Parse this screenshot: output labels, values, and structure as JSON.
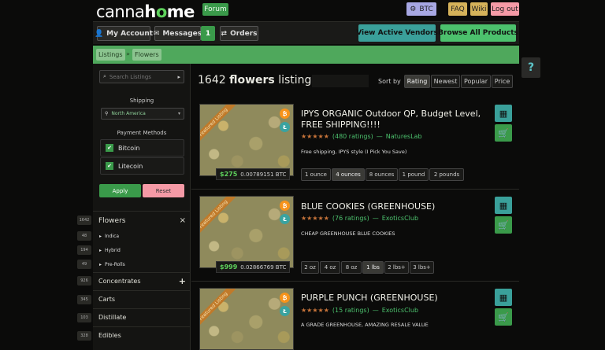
{
  "header": {
    "logo_a": "canna",
    "logo_b": "h",
    "logo_c": "o",
    "logo_d": "me",
    "forum": "Forum",
    "currency": "BTC",
    "faq": "FAQ",
    "wiki": "Wiki",
    "logout": "Log out"
  },
  "nav": {
    "account": "My Account",
    "messages": "Messages",
    "messages_count": "1",
    "orders": "Orders",
    "active_vendors": "View Active Vendors",
    "browse_all": "Browse All Products"
  },
  "breadcrumb": {
    "listings": "Listings",
    "sep": "»",
    "flowers": "Flowers"
  },
  "help": "?",
  "sidebar": {
    "search_placeholder": "Search Listings",
    "shipping_label": "Shipping",
    "shipping_value": "North America",
    "payment_label": "Payment Methods",
    "payments": [
      "Bitcoin",
      "Litecoin"
    ],
    "apply": "Apply",
    "reset": "Reset",
    "flowers": {
      "label": "Flowers",
      "count": "1642",
      "close": "×"
    },
    "subs": [
      {
        "label": "Indica",
        "count": "48"
      },
      {
        "label": "Hybrid",
        "count": "194"
      },
      {
        "label": "Pre-Rolls",
        "count": "49"
      }
    ],
    "categories": [
      {
        "label": "Concentrates",
        "count": "926",
        "plus": "+"
      },
      {
        "label": "Carts",
        "count": "345"
      },
      {
        "label": "Distillate",
        "count": "103"
      },
      {
        "label": "Edibles",
        "count": "328"
      }
    ]
  },
  "main": {
    "count": "1642",
    "count_word": "flowers",
    "count_suffix": "listings",
    "sort_label": "Sort by",
    "sort_options": [
      "Rating",
      "Newest",
      "Popular",
      "Price"
    ],
    "featured": "Featured Listing",
    "listings": [
      {
        "title": "IPYS ORGANIC Outdoor QP, Budget Level, FREE SHIPPING!!!!",
        "stars": "★★★★★",
        "ratings": "(480 ratings)",
        "dash": "—",
        "vendor": "NaturesLab",
        "desc": "Free shipping, IPYS style (I Pick You Save)",
        "price": "$275",
        "btc": "0.00789151 BTC",
        "options": [
          "1 ounce",
          "4 ounces",
          "8 ounces",
          "1 pound",
          "2 pounds"
        ],
        "active": 1
      },
      {
        "title": "BLUE COOKIES (GREENHOUSE)",
        "stars": "★★★★★",
        "ratings": "(76 ratings)",
        "dash": "—",
        "vendor": "ExoticsClub",
        "desc": "CHEAP GREENHOUSE BLUE COOKIES",
        "price": "$999",
        "btc": "0.02866769 BTC",
        "options": [
          "2 oz",
          "4 oz",
          "8 oz",
          "1 lbs",
          "2 lbs+",
          "3 lbs+"
        ],
        "active": 3
      },
      {
        "title": "PURPLE PUNCH (GREENHOUSE)",
        "stars": "★★★★★",
        "ratings": "(15 ratings)",
        "dash": "—",
        "vendor": "ExoticsClub",
        "desc": "A GRADE GREENHOUSE, AMAZING RESALE VALUE"
      }
    ]
  },
  "colors": {
    "accent_green": "#3a9a4a",
    "teal": "#3aa09a",
    "pink": "#f59aa6",
    "gold": "#d5b25a",
    "lavender": "#a7a7e3"
  }
}
